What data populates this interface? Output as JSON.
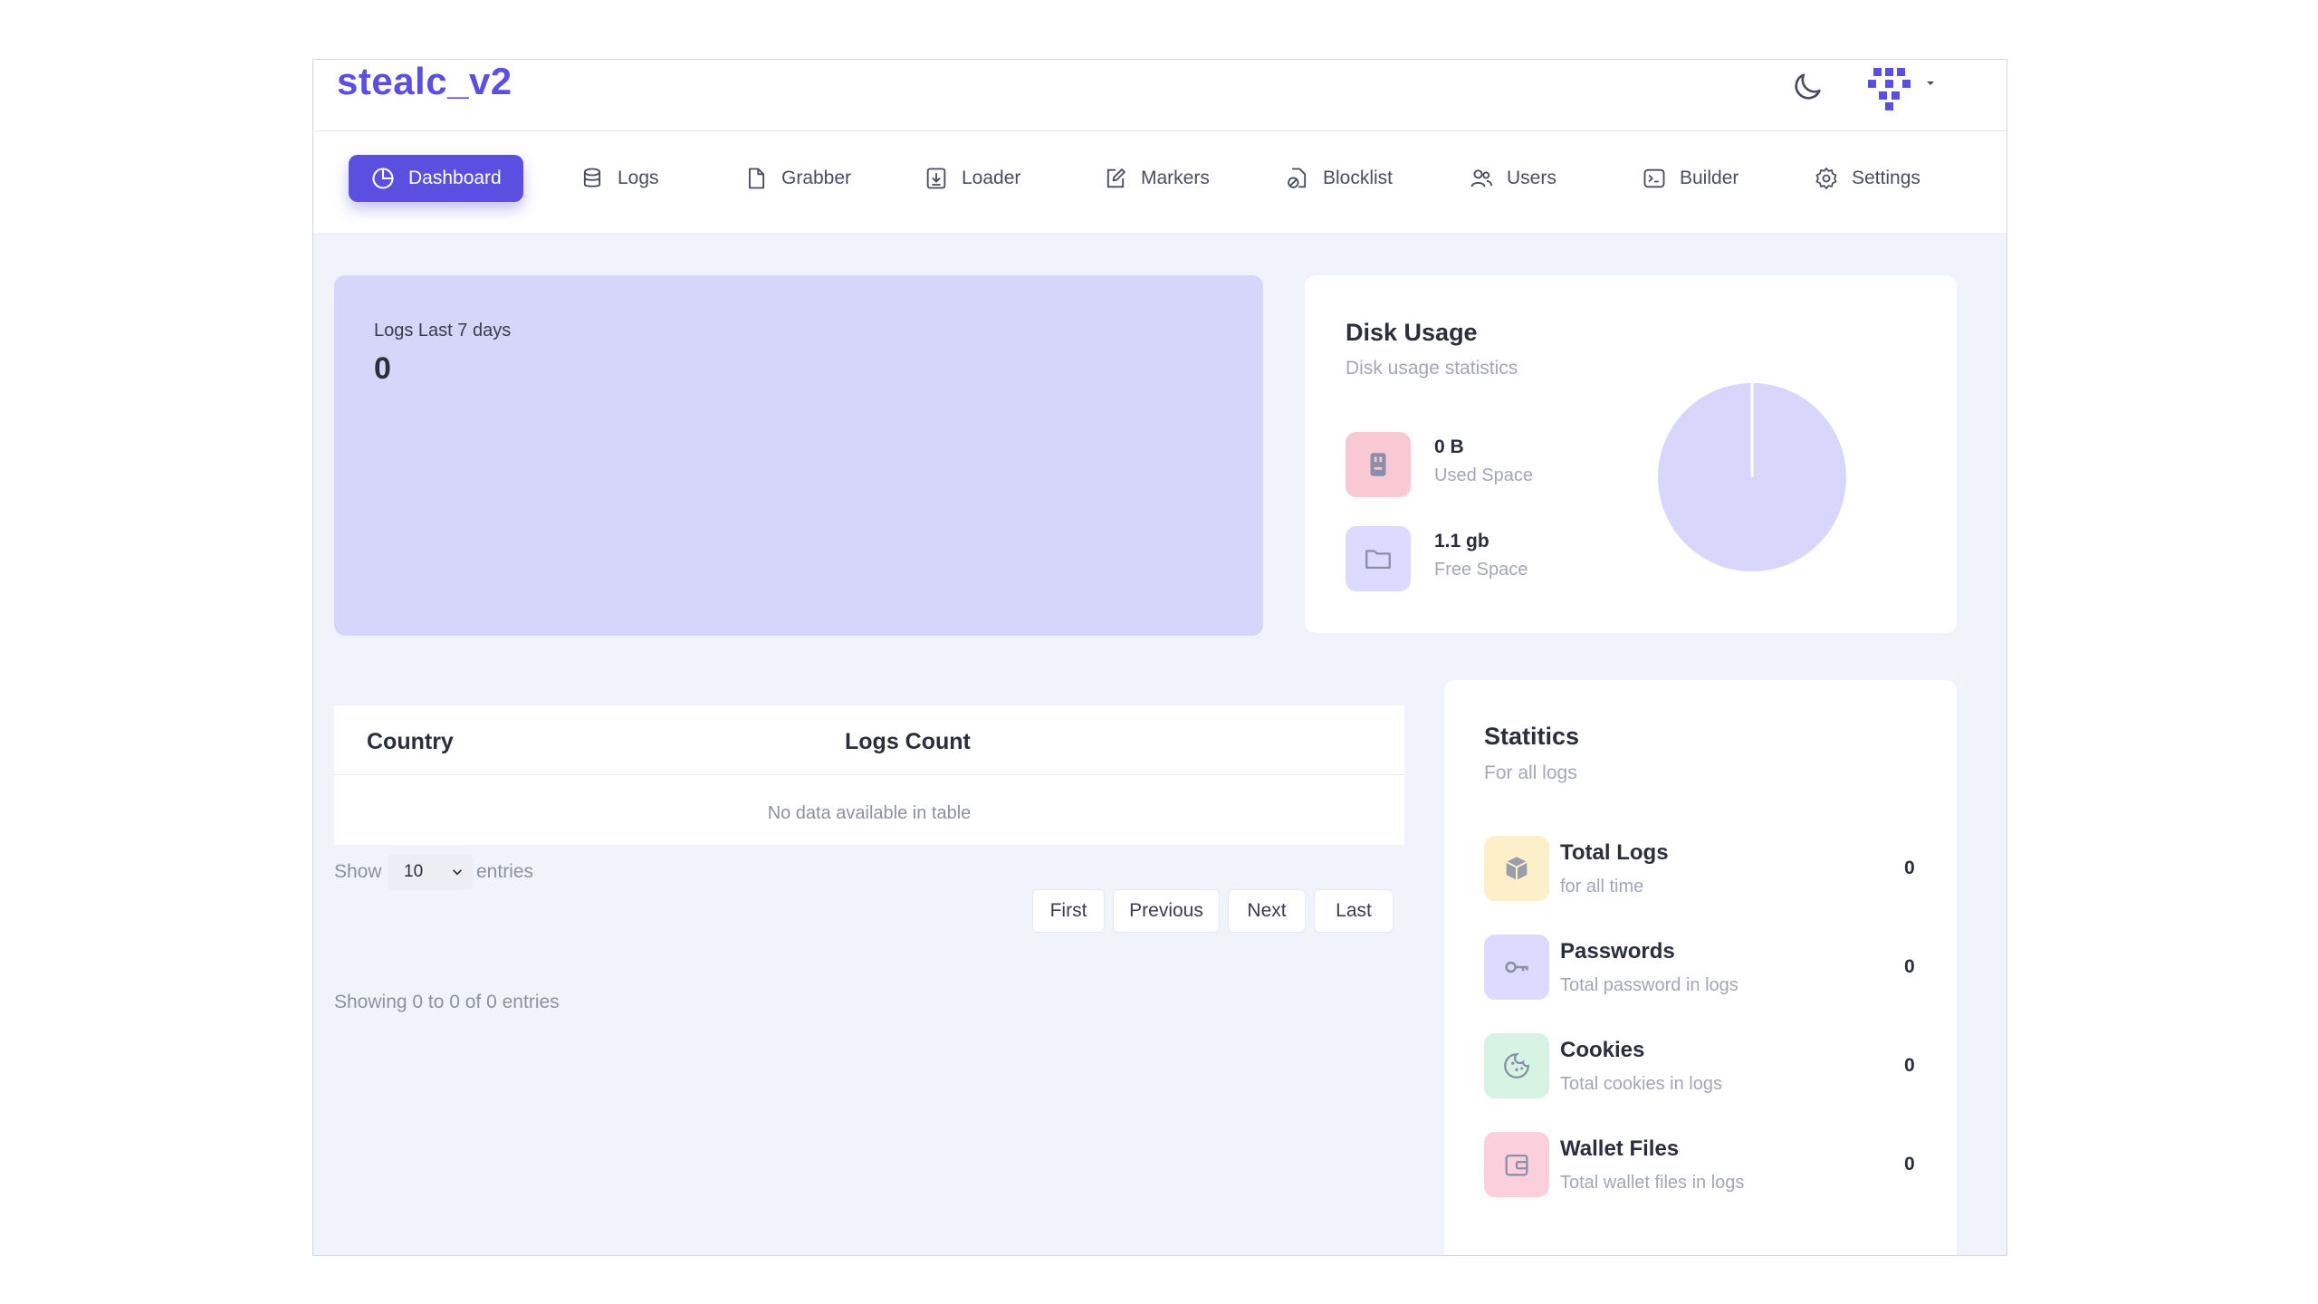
{
  "app": {
    "title": "stealc_v2"
  },
  "nav": {
    "items": [
      {
        "label": "Dashboard",
        "icon": "pie-chart-icon"
      },
      {
        "label": "Logs",
        "icon": "database-icon"
      },
      {
        "label": "Grabber",
        "icon": "file-icon"
      },
      {
        "label": "Loader",
        "icon": "download-icon"
      },
      {
        "label": "Markers",
        "icon": "edit-icon"
      },
      {
        "label": "Blocklist",
        "icon": "block-file-icon"
      },
      {
        "label": "Users",
        "icon": "users-icon"
      },
      {
        "label": "Builder",
        "icon": "terminal-icon"
      },
      {
        "label": "Settings",
        "icon": "gear-icon"
      }
    ],
    "active": "Dashboard"
  },
  "logs_card": {
    "label": "Logs Last 7 days",
    "value": "0"
  },
  "disk": {
    "title": "Disk Usage",
    "subtitle": "Disk usage statistics",
    "used": {
      "value": "0 B",
      "label": "Used Space"
    },
    "free": {
      "value": "1.1 gb",
      "label": "Free Space"
    }
  },
  "table": {
    "columns": [
      "Country",
      "Logs Count"
    ],
    "empty": "No data available in table",
    "length": {
      "show": "Show",
      "selected": "10",
      "entries": "entries"
    },
    "pager": [
      "First",
      "Previous",
      "Next",
      "Last"
    ],
    "info": "Showing 0 to 0 of 0 entries"
  },
  "stats": {
    "title": "Statitics",
    "subtitle": "For all logs",
    "items": [
      {
        "title": "Total Logs",
        "sub": "for all time",
        "value": "0",
        "icon": "box-icon"
      },
      {
        "title": "Passwords",
        "sub": "Total password in logs",
        "value": "0",
        "icon": "key-icon"
      },
      {
        "title": "Cookies",
        "sub": "Total cookies in logs",
        "value": "0",
        "icon": "cookie-icon"
      },
      {
        "title": "Wallet Files",
        "sub": "Total wallet files in logs",
        "value": "0",
        "icon": "wallet-icon"
      }
    ]
  },
  "colors": {
    "accent": "#5a4fe0",
    "logs_card_bg": "#d6d5fa",
    "pie_fill": "#d8d6fa",
    "used_icon_bg": "#f9c9d3",
    "free_icon_bg": "#dcdaff",
    "total_logs_bg": "#fdf0c8",
    "passwords_bg": "#dcdaff",
    "cookies_bg": "#d7f3e3",
    "wallet_bg": "#fbd0da"
  }
}
